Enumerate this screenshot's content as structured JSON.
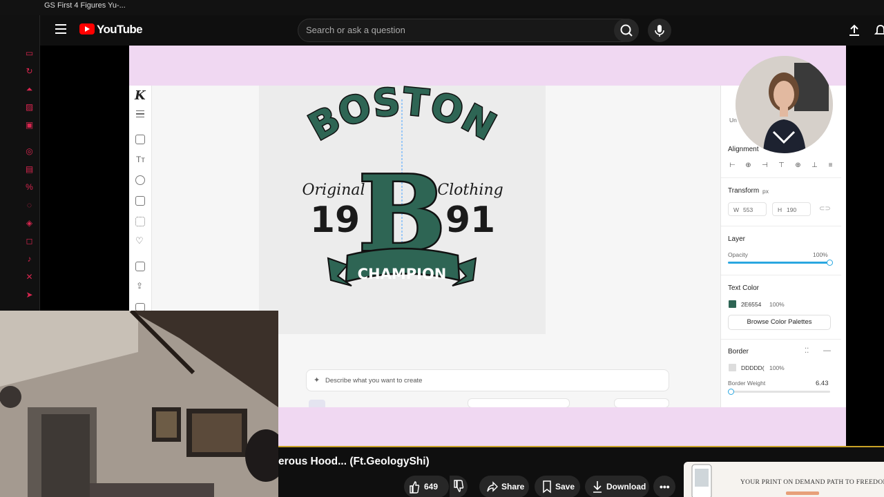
{
  "browser": {
    "tab_title": "GS First 4 Figures Yu-..."
  },
  "youtube": {
    "logo_text": "YouTube",
    "search_placeholder": "Search or ask a question"
  },
  "video": {
    "title": "erous Hood... (Ft.GeologyShi)",
    "likes": "649",
    "share_label": "Share",
    "save_label": "Save",
    "download_label": "Download"
  },
  "design": {
    "line_boston": "BOSTON",
    "line_original": "Original",
    "line_clothing": "Clothing",
    "year_left": "19",
    "year_right": "91",
    "monogram": "B",
    "banner": "CHAMPION",
    "colors": {
      "primary": "#2E6554",
      "accent": "#1f8c5a",
      "outline": "#1a1a1a"
    }
  },
  "panel": {
    "truncated_label": "Un",
    "alignment_label": "Alignment",
    "transform_label": "Transform",
    "transform_unit": "px",
    "w_label": "W",
    "w_value": "553",
    "h_label": "H",
    "h_value": "190",
    "layer_label": "Layer",
    "opacity_label": "Opacity",
    "opacity_value": "100%",
    "opacity_level": 1.0,
    "text_color_label": "Text Color",
    "text_color_hex": "2E6554",
    "text_color_opacity": "100%",
    "browse_palettes": "Browse Color Palettes",
    "border_label": "Border",
    "border_color_hex": "DDDDD(",
    "border_opacity": "100%",
    "border_weight_label": "Border Weight",
    "border_weight_value": "6.43",
    "border_weight_level": 0.0
  },
  "prompt": {
    "placeholder": "Describe what you want to create"
  },
  "ad": {
    "headline": "YOUR PRINT ON DEMAND PATH TO FREEDOM"
  }
}
